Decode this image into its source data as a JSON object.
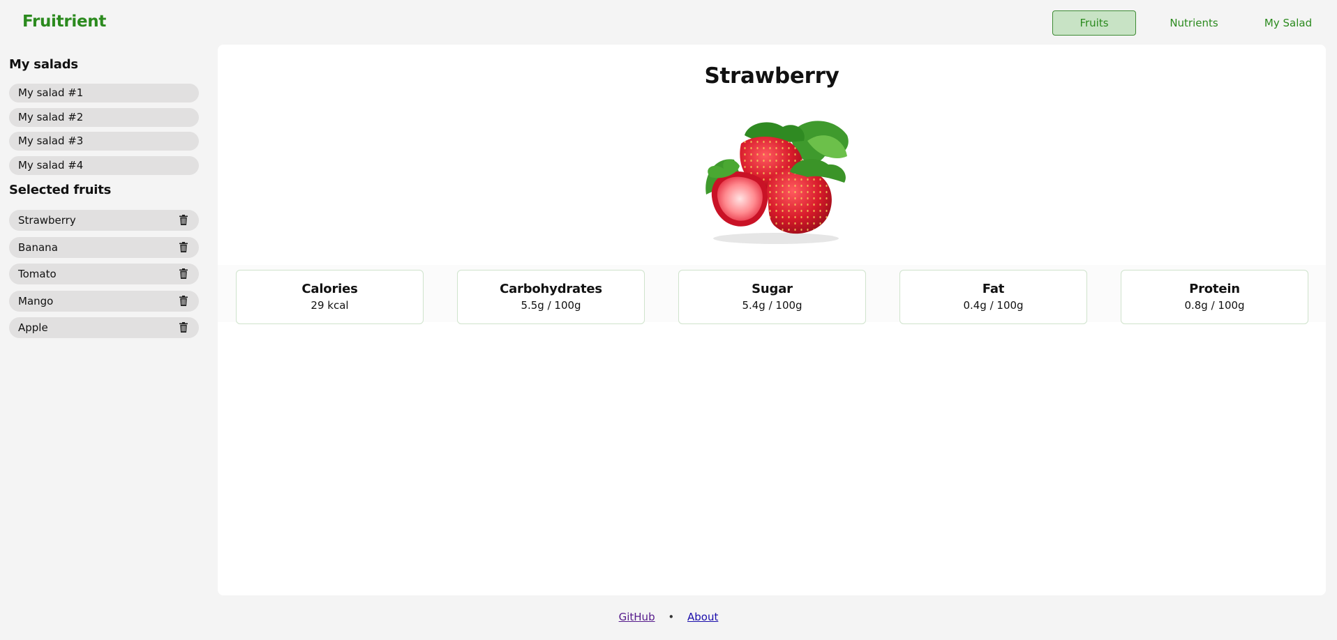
{
  "app": {
    "name": "Fruitrient"
  },
  "nav": {
    "items": [
      {
        "label": "Fruits",
        "active": true
      },
      {
        "label": "Nutrients",
        "active": false
      },
      {
        "label": "My Salad",
        "active": false
      }
    ]
  },
  "sidebar": {
    "salads_heading": "My salads",
    "salads": [
      {
        "label": "My salad #1"
      },
      {
        "label": "My salad #2"
      },
      {
        "label": "My salad #3"
      },
      {
        "label": "My salad #4"
      }
    ],
    "fruits_heading": "Selected fruits",
    "fruits": [
      {
        "label": "Strawberry",
        "icon": "trash-icon"
      },
      {
        "label": "Banana",
        "icon": "trash-icon"
      },
      {
        "label": "Tomato",
        "icon": "trash-icon"
      },
      {
        "label": "Mango",
        "icon": "trash-icon"
      },
      {
        "label": "Apple",
        "icon": "trash-icon"
      }
    ]
  },
  "main": {
    "title": "Strawberry",
    "image": "strawberry-image",
    "nutrients": [
      {
        "label": "Calories",
        "value": "29 kcal"
      },
      {
        "label": "Carbohydrates",
        "value": "5.5g / 100g"
      },
      {
        "label": "Sugar",
        "value": "5.4g / 100g"
      },
      {
        "label": "Fat",
        "value": "0.4g / 100g"
      },
      {
        "label": "Protein",
        "value": "0.8g / 100g"
      }
    ]
  },
  "footer": {
    "github": "GitHub",
    "separator": "•",
    "about": "About"
  },
  "colors": {
    "brand": "#2b8a1e",
    "nav_active_bg": "#c8e3c5",
    "pill_bg": "#e1e0e0",
    "page_bg": "#f4f4f4"
  }
}
